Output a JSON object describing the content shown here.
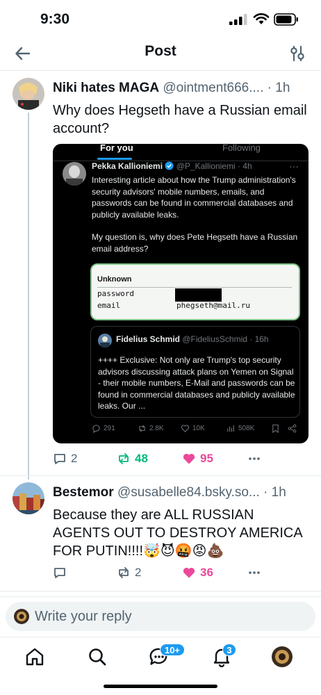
{
  "status_bar": {
    "time": "9:30"
  },
  "header": {
    "title": "Post"
  },
  "post1": {
    "name": "Niki hates MAGA",
    "handle": "@ointment666....",
    "dot": "·",
    "time": "1h",
    "text": "Why does Hegseth have a Russian email account?",
    "counts": {
      "replies": "2",
      "reposts": "48",
      "likes": "95"
    }
  },
  "embed": {
    "tab_for_you": "For you",
    "tab_following": "Following",
    "author_name": "Pekka Kallioniemi",
    "author_handle": "@P_Kallioniemi · 4h",
    "more": "···",
    "text1": "Interesting article about how the Trump administration's security advisors' mobile numbers, emails, and passwords can be found in commercial databases and publicly available leaks.",
    "text2": "My question is, why does Pete Hegseth have a Russian email address?",
    "card": {
      "title": "Unknown",
      "label_password": "password",
      "label_email": "email",
      "email_value": "phegseth@mail.ru"
    },
    "quote": {
      "name": "Fidelius Schmid",
      "handle": "@FideliusSchmid · 16h",
      "text": "++++ Exclusive: Not only are Trump's top security advisors discussing attack plans on Yemen on Signal - their mobile numbers, E-Mail and passwords can be found in commercial databases and publicly available leaks. Our ..."
    },
    "stats": {
      "replies": "291",
      "reposts": "2.8K",
      "likes": "10K",
      "views": "508K"
    }
  },
  "post2": {
    "name": "Bestemor",
    "handle": "@susabelle84.bsky.so...",
    "dot": "·",
    "time": "1h",
    "text": "Because they are ALL RUSSIAN AGENTS OUT TO DESTROY AMERICA FOR PUTIN!!!!🤯😈🤬😡💩",
    "counts": {
      "replies": "",
      "reposts": "2",
      "likes": "36"
    }
  },
  "reply_bar": {
    "placeholder": "Write your reply"
  },
  "tabbar": {
    "chat_badge": "10+",
    "notif_badge": "3"
  },
  "colors": {
    "accent": "#1d9bf0",
    "repost": "#00ba7c",
    "like": "#ec4899",
    "muted": "#536471"
  },
  "icons": [
    "back-arrow-icon",
    "filter-icon",
    "reply-icon",
    "repost-icon",
    "heart-icon",
    "more-icon",
    "home-icon",
    "search-icon",
    "chat-icon",
    "bell-icon"
  ]
}
